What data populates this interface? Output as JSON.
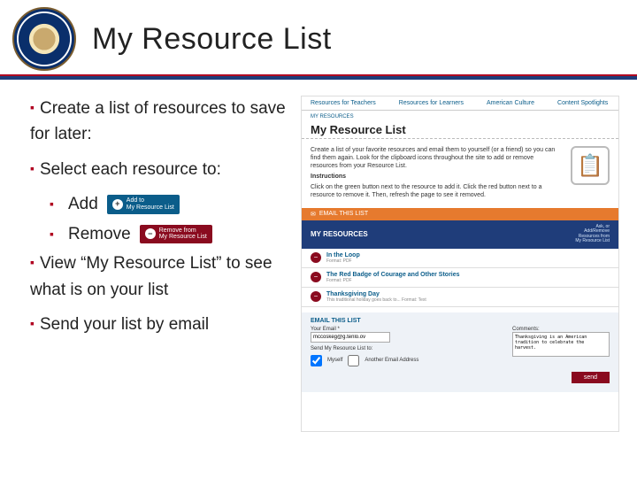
{
  "header": {
    "title": "My Resource List"
  },
  "bullets": {
    "a": "Create a list of resources to save for later:",
    "b": "Select each resource to:",
    "b_add": "Add",
    "b_remove": "Remove",
    "c": "View “My Resource List” to see what is on your list",
    "d": "Send your list by email"
  },
  "badges": {
    "add": "Add to\nMy Resource List",
    "remove": "Remove from\nMy Resource List"
  },
  "screenshot": {
    "tabs": [
      "Resources for Teachers",
      "Resources for Learners",
      "American Culture",
      "Content Spotlights"
    ],
    "breadcrumb": "MY RESOURCES",
    "page_title": "My Resource List",
    "intro": "Create a list of your favorite resources and email them to yourself (or a friend) so you can find them again. Look for the clipboard icons throughout the site to add or remove resources from your Resource List.",
    "instructions_h": "Instructions",
    "instructions": "Click on the green button next to the resource to add it. Click the red button next to a resource to remove it. Then, refresh the page to see it removed.",
    "email_list_btn": "EMAIL THIS LIST",
    "my_resources": "MY RESOURCES",
    "ask_label": "Ask, or\nAdd/Remove\nResources from\nMy Resource List",
    "rows": [
      {
        "title": "In the Loop",
        "sub": "Format: PDF"
      },
      {
        "title": "The Red Badge of Courage and Other Stories",
        "sub": "Format: PDF"
      },
      {
        "title": "Thanksgiving Day",
        "sub": "This traditional holiday goes back to...\nFormat: Text"
      }
    ],
    "email_section": {
      "heading": "EMAIL THIS LIST",
      "your_email": "Your Email *",
      "email_value": "mccoskeg@g.tenlo.ov",
      "send_label": "Send My Resource List to:",
      "opt_myself": "Myself",
      "opt_other": "Another Email Address",
      "comments": "Comments:",
      "comments_value": "Thanksgiving is an American tradition to celebrate the harvest.",
      "send": "send"
    }
  }
}
